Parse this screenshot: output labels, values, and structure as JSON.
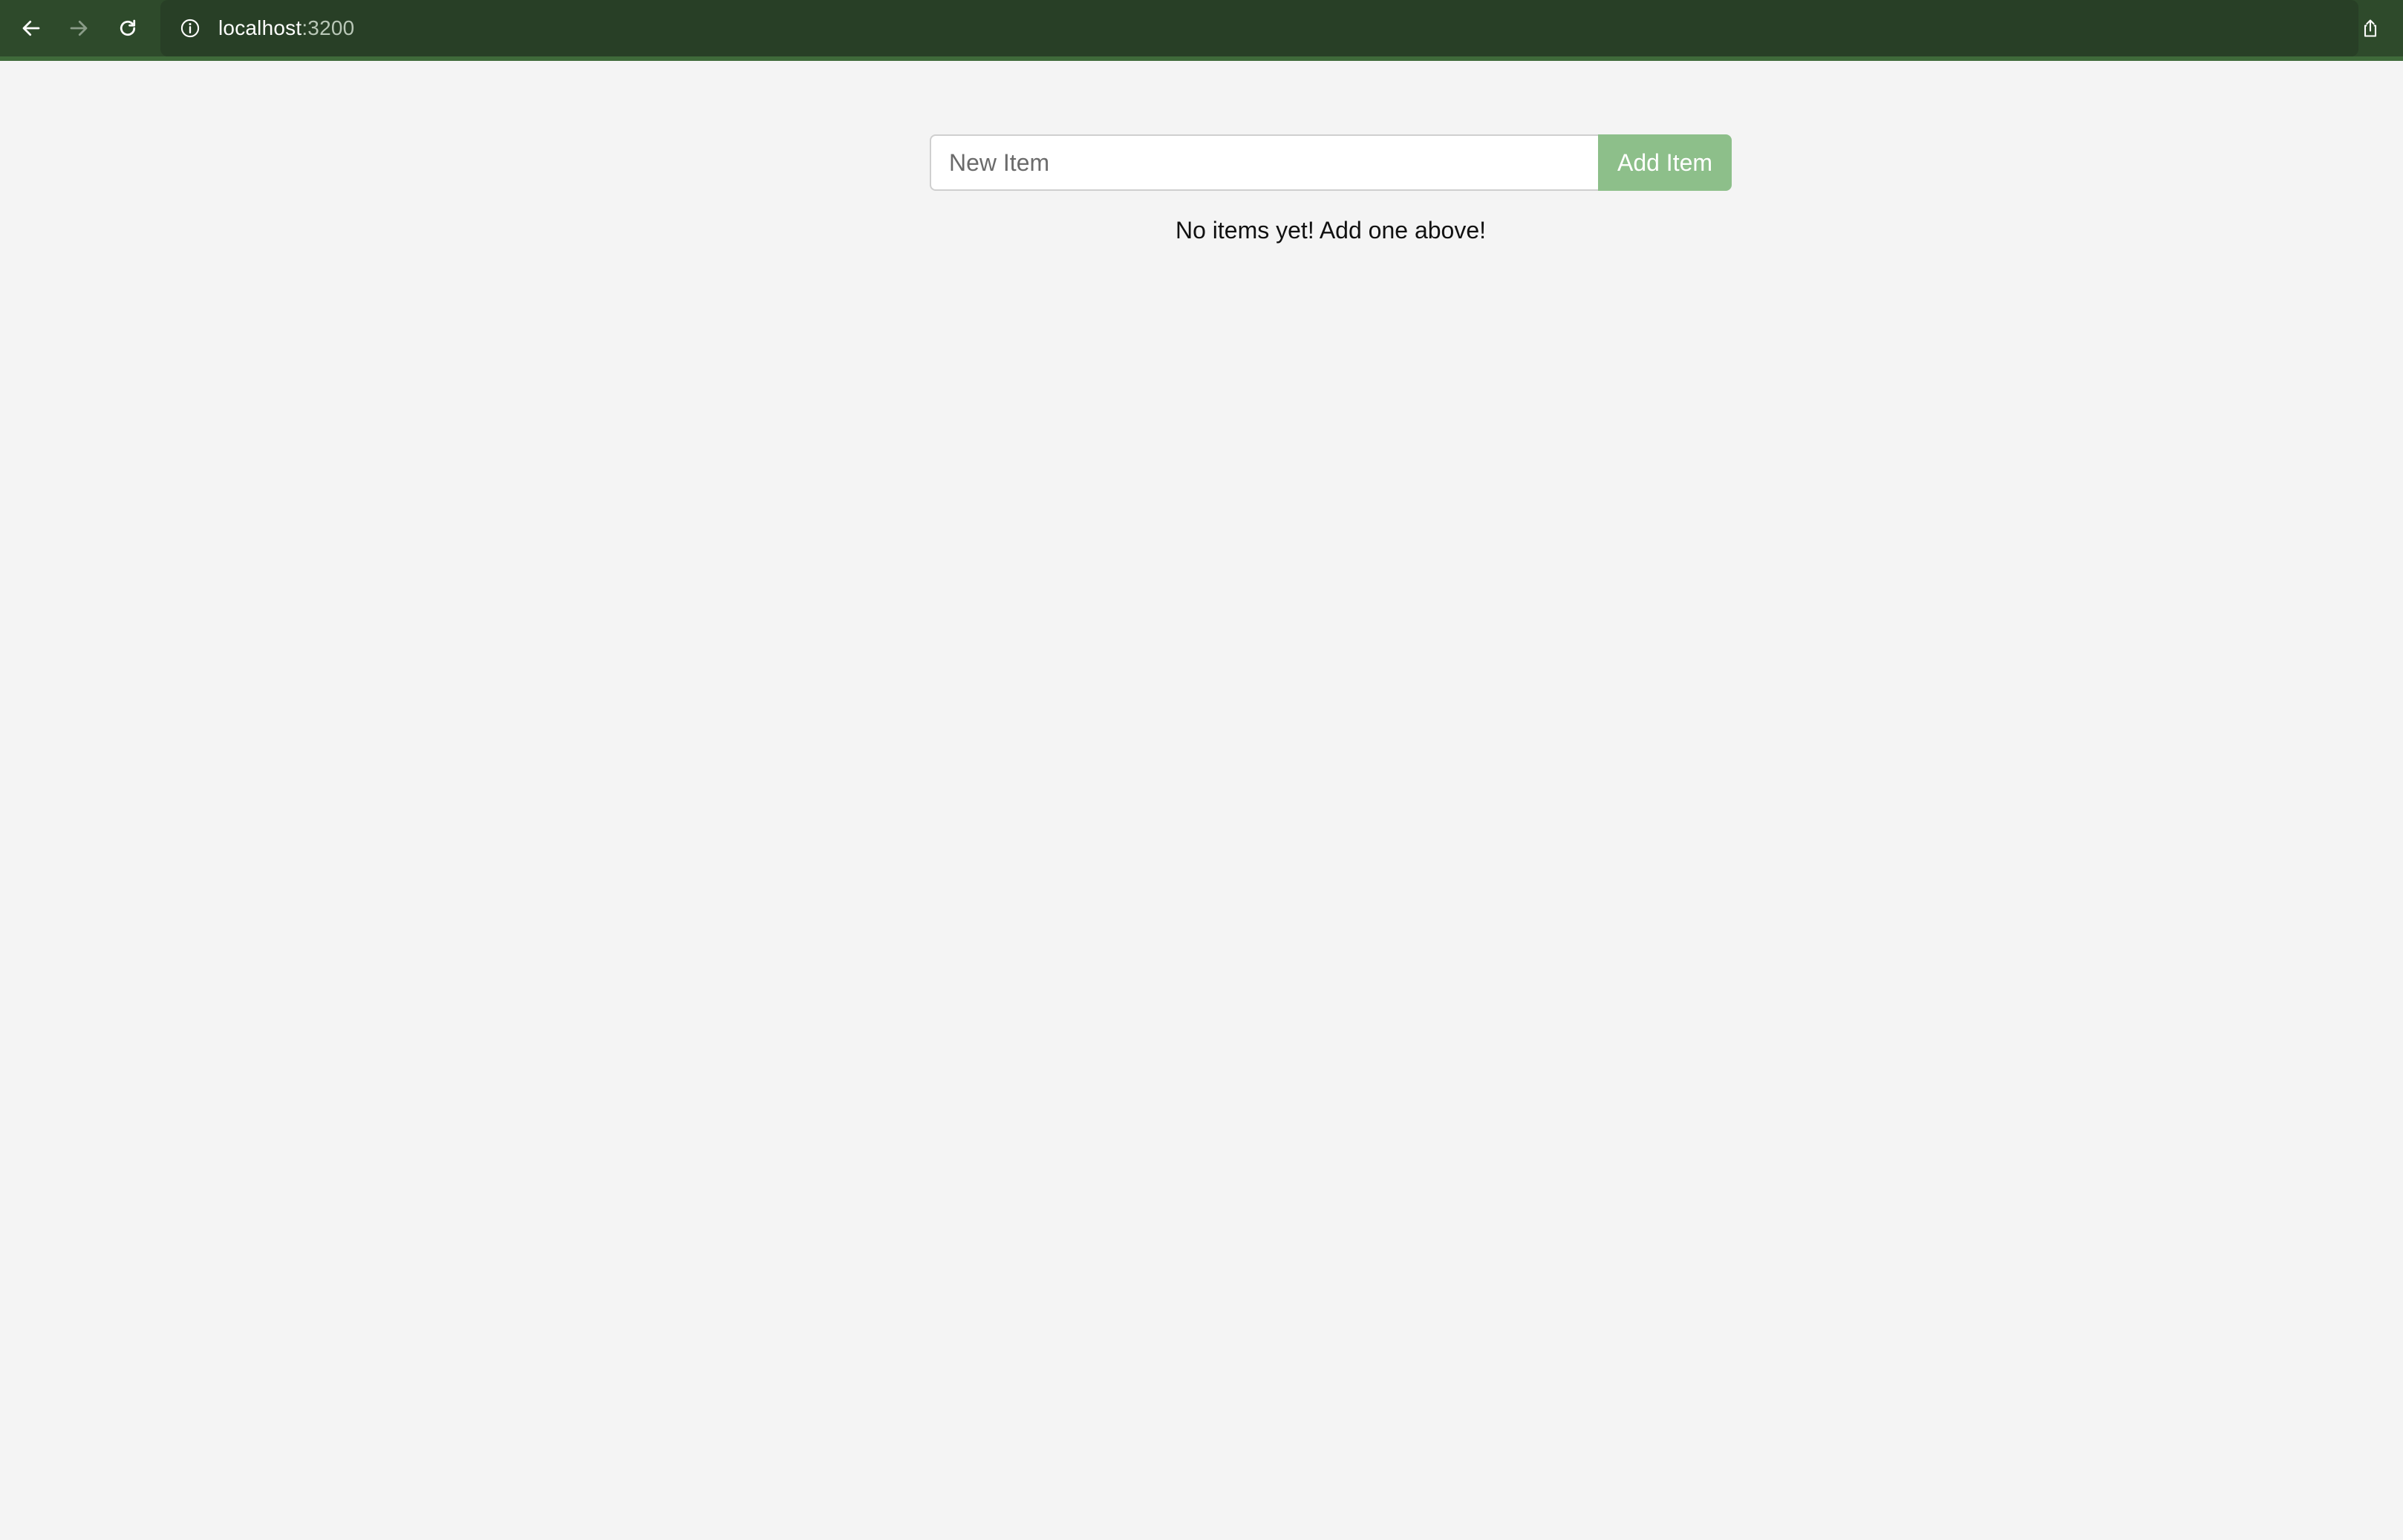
{
  "browser": {
    "url_host": "localhost",
    "url_port": ":3200",
    "bar_color": "#2e4a2b",
    "icons": {
      "back": "arrow-left-icon",
      "forward": "arrow-right-icon",
      "reload": "reload-icon",
      "site_info": "info-icon",
      "share": "share-icon"
    }
  },
  "form": {
    "input_placeholder": "New Item",
    "input_value": "",
    "add_button_label": "Add Item",
    "add_button_color": "#8dbf8a"
  },
  "list": {
    "empty_message": "No items yet! Add one above!",
    "items": []
  }
}
